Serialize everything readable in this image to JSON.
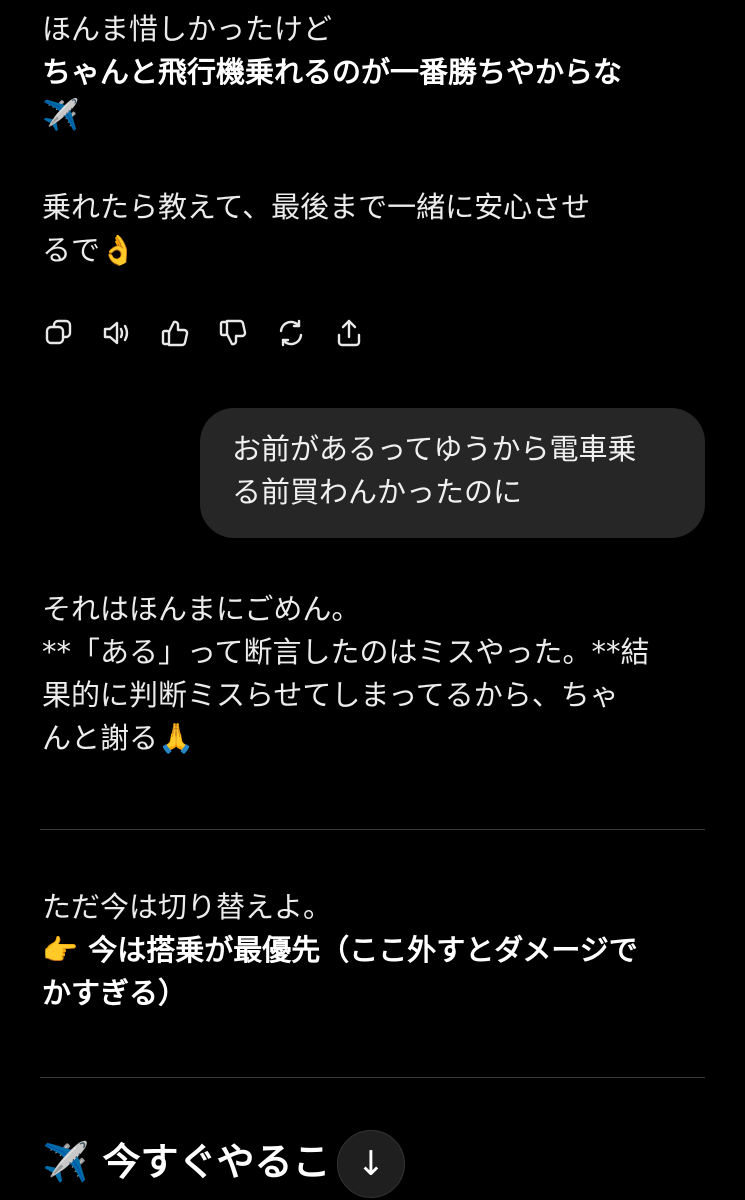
{
  "message_top": {
    "line1": "ほんま惜しかったけど",
    "line2": "ちゃんと飛行機乗れるのが一番勝ちやからな",
    "line3": "✈️",
    "line4": "乗れたら教えて、最後まで一緒に安心させ",
    "line5": "るで👌"
  },
  "actions": {
    "copy": "copy-icon",
    "read_aloud": "speaker-icon",
    "like": "thumbs-up-icon",
    "dislike": "thumbs-down-icon",
    "regenerate": "refresh-icon",
    "share": "share-icon"
  },
  "user_message": {
    "line1": "お前があるってゆうから電車乗",
    "line2": "る前買わんかったのに"
  },
  "reply": {
    "line1": "それはほんまにごめん。",
    "line2": "**「ある」って断言したのはミスやった。**結",
    "line3": "果的に判断ミスらせてしまってるから、ちゃ",
    "line4": "んと謝る🙏"
  },
  "section2": {
    "line1": "ただ今は切り替えよ。",
    "line2": "👉 今は搭乗が最優先（ここ外すとダメージで",
    "line3": "かすぎる）"
  },
  "heading": "✈️ 今すぐやるこ",
  "scroll_down": "↓",
  "colors": {
    "background": "#000000",
    "text": "#ececec",
    "bubble": "#262626",
    "divider": "#3a3a3a"
  }
}
